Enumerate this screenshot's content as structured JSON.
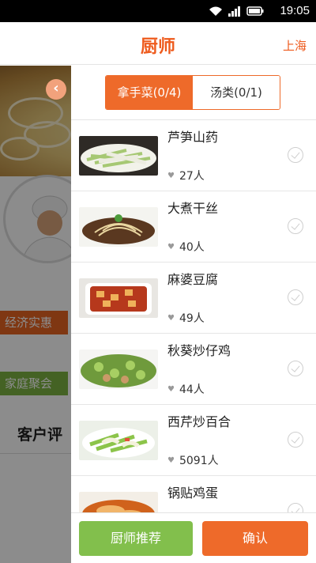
{
  "status_bar": {
    "time": "19:05"
  },
  "header": {
    "title": "厨师",
    "city": "上海"
  },
  "background": {
    "tags": [
      "经济实惠",
      "家庭聚会"
    ],
    "review_title": "客户评"
  },
  "drawer": {
    "tabs": [
      {
        "label": "拿手菜(0/4)",
        "active": true
      },
      {
        "label": "汤类(0/1)",
        "active": false
      }
    ],
    "dishes": [
      {
        "name": "芦笋山药",
        "likes": "27人"
      },
      {
        "name": "大煮干丝",
        "likes": "40人"
      },
      {
        "name": "麻婆豆腐",
        "likes": "49人"
      },
      {
        "name": "秋葵炒仔鸡",
        "likes": "44人"
      },
      {
        "name": "西芹炒百合",
        "likes": "5091人"
      },
      {
        "name": "锅贴鸡蛋",
        "likes": ""
      }
    ],
    "buttons": {
      "recommend": "厨师推荐",
      "confirm": "确认"
    }
  },
  "colors": {
    "accent": "#ee6a2a",
    "green": "#82bf4c"
  }
}
